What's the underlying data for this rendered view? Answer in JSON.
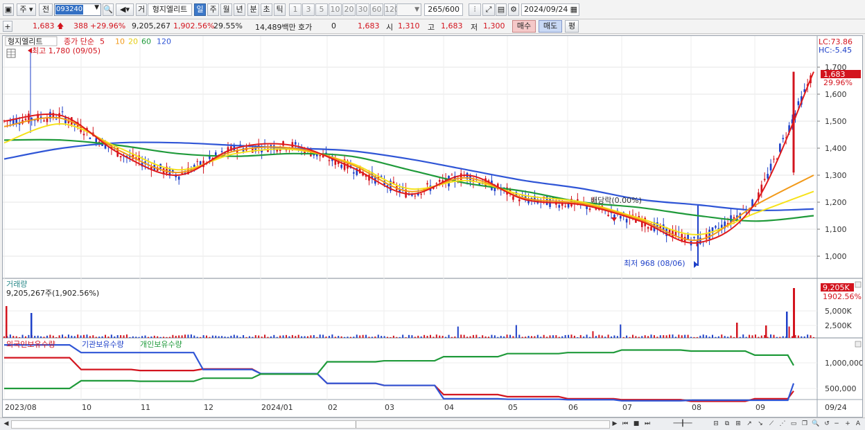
{
  "toolbar": {
    "market": "주",
    "prev": "전",
    "code": "093240",
    "btn_geo": "거",
    "name": "형지엘리트",
    "periods": [
      "일",
      "주",
      "월",
      "년",
      "분",
      "초",
      "틱"
    ],
    "intervals": [
      "1",
      "3",
      "5",
      "10",
      "20",
      "30",
      "60",
      "120"
    ],
    "count": "265",
    "count_max": "/600",
    "date": "2024/09/24"
  },
  "quote": {
    "price": "1,683",
    "change": "388",
    "change_rate": "+29.96%",
    "volume": "9,205,267",
    "volume_rate": "1,902.56%",
    "turnover": "29.55%",
    "amount": "14,489백만",
    "hoga_label": "호가",
    "hoga": "0",
    "ask": "1,683",
    "open_label": "시",
    "open": "1,310",
    "high_label": "고",
    "high": "1,683",
    "low_label": "저",
    "low": "1,300",
    "buy_button": "매수",
    "sell_button": "매도",
    "eval_button": "평"
  },
  "price_panel": {
    "title": "형지엘리트",
    "ma_label": "종가 단순",
    "ma_periods": [
      "5",
      "10",
      "20",
      "60",
      "120"
    ],
    "high_note": "최고 1,780 (09/05)",
    "low_note": "최저 968 (08/06)",
    "dividend_note": "배당락(0.00%)",
    "lc": "LC:73.86",
    "hc": "HC:-5.45",
    "last_price_tag": "1,683",
    "last_rate_tag": "29.96%",
    "y_ticks": [
      "1,700",
      "1,600",
      "1,500",
      "1,400",
      "1,300",
      "1,200",
      "1,100",
      "1,000"
    ]
  },
  "volume_panel": {
    "title": "거래량",
    "info": "9,205,267주(1,902.56%)",
    "tag_value": "9,205K",
    "tag_rate": "1902.56%",
    "y_ticks": [
      "5,000K",
      "2,500K"
    ]
  },
  "holdings_panel": {
    "legend": [
      "외국인보유수량",
      "기관보유수량",
      "개인보유수량"
    ],
    "y_ticks": [
      "1,000,000",
      "500,000"
    ]
  },
  "x_axis": {
    "labels": [
      "2023/08",
      "10",
      "11",
      "12",
      "2024/01",
      "02",
      "03",
      "04",
      "05",
      "06",
      "07",
      "08",
      "09"
    ],
    "right_label": "09/24"
  },
  "colors": {
    "ma5": "#e01b1b",
    "ma10": "#f29a1a",
    "ma20": "#f6e21a",
    "ma60": "#1f9a3a",
    "ma120": "#2f55d6",
    "up": "#d3141e",
    "down": "#1d3fc8"
  },
  "chart_data": [
    {
      "type": "line",
      "title": "",
      "x": [
        "2023/08",
        "09",
        "10",
        "11",
        "12",
        "2024/01",
        "02",
        "03",
        "04",
        "05",
        "06",
        "07",
        "08",
        "09",
        "09/24"
      ],
      "series": [
        {
          "name": "5",
          "values": [
            1500,
            1520,
            1380,
            1300,
            1400,
            1410,
            1330,
            1230,
            1300,
            1210,
            1190,
            1130,
            1050,
            1200,
            1683
          ]
        },
        {
          "name": "10",
          "values": [
            1480,
            1510,
            1390,
            1310,
            1390,
            1400,
            1340,
            1240,
            1290,
            1215,
            1195,
            1135,
            1060,
            1190,
            1300
          ]
        },
        {
          "name": "20",
          "values": [
            1420,
            1490,
            1400,
            1320,
            1380,
            1395,
            1345,
            1250,
            1280,
            1225,
            1200,
            1140,
            1080,
            1160,
            1240
          ]
        },
        {
          "name": "60",
          "values": [
            1430,
            1430,
            1410,
            1380,
            1370,
            1380,
            1370,
            1320,
            1270,
            1240,
            1200,
            1180,
            1150,
            1130,
            1150
          ]
        },
        {
          "name": "120",
          "values": [
            1360,
            1400,
            1420,
            1420,
            1410,
            1400,
            1390,
            1360,
            1320,
            1280,
            1250,
            1210,
            1190,
            1170,
            1175
          ]
        }
      ],
      "ylim": [
        950,
        1780
      ]
    },
    {
      "type": "line",
      "title": "",
      "x": [
        "2023/08",
        "10",
        "11",
        "12",
        "2024/01",
        "02",
        "03",
        "04",
        "05",
        "06",
        "07",
        "08",
        "09",
        "09/24"
      ],
      "series": [
        {
          "name": "외국인보유수량",
          "values": [
            1100000,
            870000,
            850000,
            880000,
            790000,
            600000,
            560000,
            380000,
            340000,
            300000,
            280000,
            250000,
            300000,
            450000
          ]
        },
        {
          "name": "기관보유수량",
          "values": [
            1350000,
            1200000,
            1200000,
            870000,
            790000,
            600000,
            560000,
            300000,
            290000,
            280000,
            260000,
            270000,
            270000,
            600000
          ]
        },
        {
          "name": "개인보유수량",
          "values": [
            500000,
            650000,
            640000,
            700000,
            780000,
            1020000,
            1040000,
            1120000,
            1180000,
            1200000,
            1250000,
            1230000,
            1150000,
            950000
          ]
        }
      ]
    }
  ]
}
